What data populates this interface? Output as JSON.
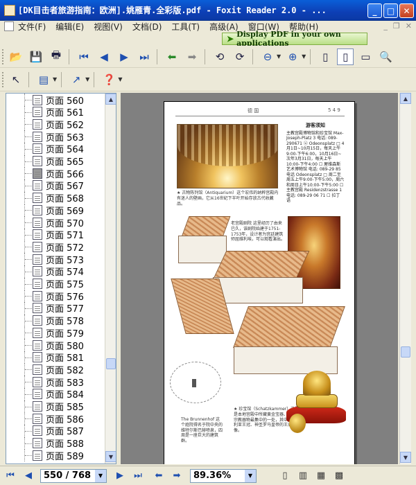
{
  "window": {
    "title": "[DK目击者旅游指南：欧洲].姚雁青.全彩版.pdf - Foxit Reader 2.0 - ...",
    "controls": {
      "minimize": "_",
      "maximize": "□",
      "close": "✕"
    }
  },
  "menu": {
    "items": [
      "文件(F)",
      "编辑(E)",
      "视图(V)",
      "文档(D)",
      "工具(T)",
      "高级(A)",
      "窗口(W)",
      "帮助(H)"
    ]
  },
  "banner": {
    "text": "Display PDF in your own applications"
  },
  "bookmarks": {
    "selected": "页面 566",
    "items": [
      "页面 560",
      "页面 561",
      "页面 562",
      "页面 563",
      "页面 564",
      "页面 565",
      "页面 566",
      "页面 567",
      "页面 568",
      "页面 569",
      "页面 570",
      "页面 571",
      "页面 572",
      "页面 573",
      "页面 574",
      "页面 575",
      "页面 576",
      "页面 577",
      "页面 578",
      "页面 579",
      "页面 580",
      "页面 581",
      "页面 582",
      "页面 583",
      "页面 584",
      "页面 585",
      "页面 586",
      "页面 587",
      "页面 588",
      "页面 589"
    ]
  },
  "pdf_page": {
    "header_left": "德 国",
    "header_right": "5 4 9",
    "info_title": "游客须知",
    "info_body": "主教宫殿博物馆和珍宝馆 Max-Joseph-Platz 3 电话: 089-290671 ⓤ Odeonsplatz □ 4月1日~10月15日，每天上午9:00-下午6:00，10月16日~次年3月31日，每天上午10:00-下午4:00 ☐ 屋维森斯艺术博物馆 电话: 089-29 85 电话 Odeonsplatz □ 周二至周五上午9:00-下午5:00，周六和周日上午10:00-下午5:00 ☐ 主教宫殿 Residenzstrasse 1 电话: 089-29 06 71 ☐ 拉丁 语",
    "caption_antiquarium": "★ 古物陈列馆（Antiquarium）这个宏伟的纳粹宫殿内有迷人的壁画，它从16世纪下半叶开始存放古代收藏品。",
    "caption_theatre": "老宫殿剧院 这里经历了由来已久，该剧院始建于1751-1753年，设计者为宫廷建筑师屈维利埃，可以观看演出。",
    "caption_treasury": "★ 珍宝馆（Schatzkammer）这里是本地宫殿中所藏黄金宝器、世俗及宗教器物最集中的一处，其中有巴伐利亚王冠、神圣罗马皇帝的王冠及雕像。",
    "caption_brunnenhof": "The Brunnenhof 这个庭院得名于院中央的维特尔斯巴赫喷泉，四周是一座巨大的建筑群。"
  },
  "status": {
    "page_field": "550 / 768",
    "zoom": "89.36%"
  }
}
